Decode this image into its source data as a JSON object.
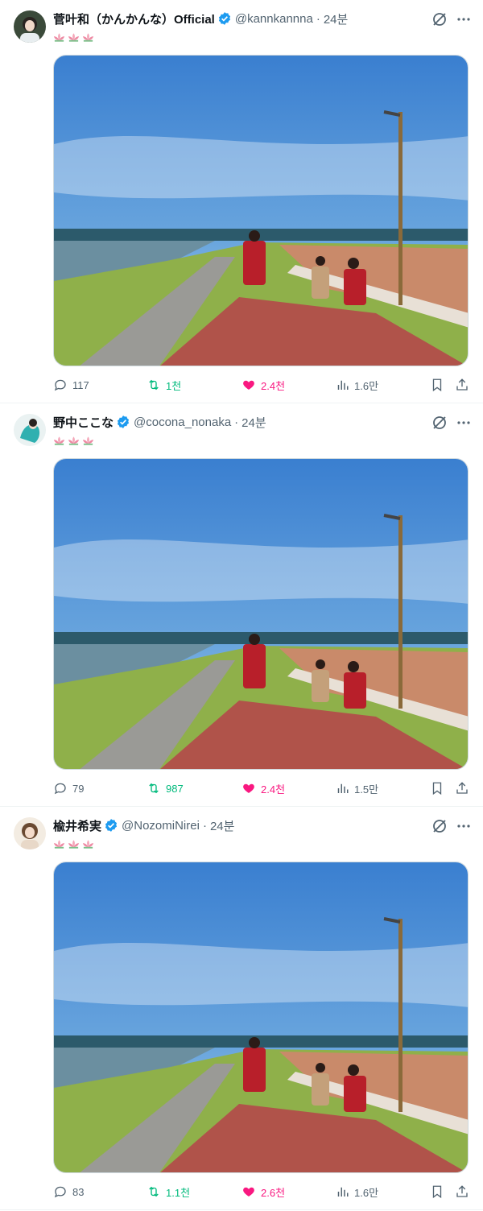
{
  "tweets": [
    {
      "name": "菅叶和（かんかんな）Official",
      "handle": "@kannkannna",
      "dot": "·",
      "time": "24분",
      "replies": "117",
      "retweets": "1천",
      "likes": "2.4천",
      "views": "1.6만"
    },
    {
      "name": "野中ここな",
      "handle": "@cocona_nonaka",
      "dot": "·",
      "time": "24분",
      "replies": "79",
      "retweets": "987",
      "likes": "2.4천",
      "views": "1.5만"
    },
    {
      "name": "楡井希実",
      "handle": "@NozomiNirei",
      "dot": "·",
      "time": "24분",
      "replies": "83",
      "retweets": "1.1천",
      "likes": "2.6천",
      "views": "1.6만"
    }
  ],
  "icons": {
    "reply": "reply-icon",
    "retweet": "retweet-icon",
    "like": "heart-icon",
    "views": "views-icon",
    "bookmark": "bookmark-icon",
    "share": "share-icon",
    "verified": "verified-badge-icon",
    "grok": "grok-icon",
    "more": "more-icon",
    "lotus": "lotus-emoji"
  },
  "colors": {
    "verified": "#1d9bf0",
    "retweet_active": "#00ba7c",
    "like_active": "#f91880",
    "muted": "#536471"
  }
}
